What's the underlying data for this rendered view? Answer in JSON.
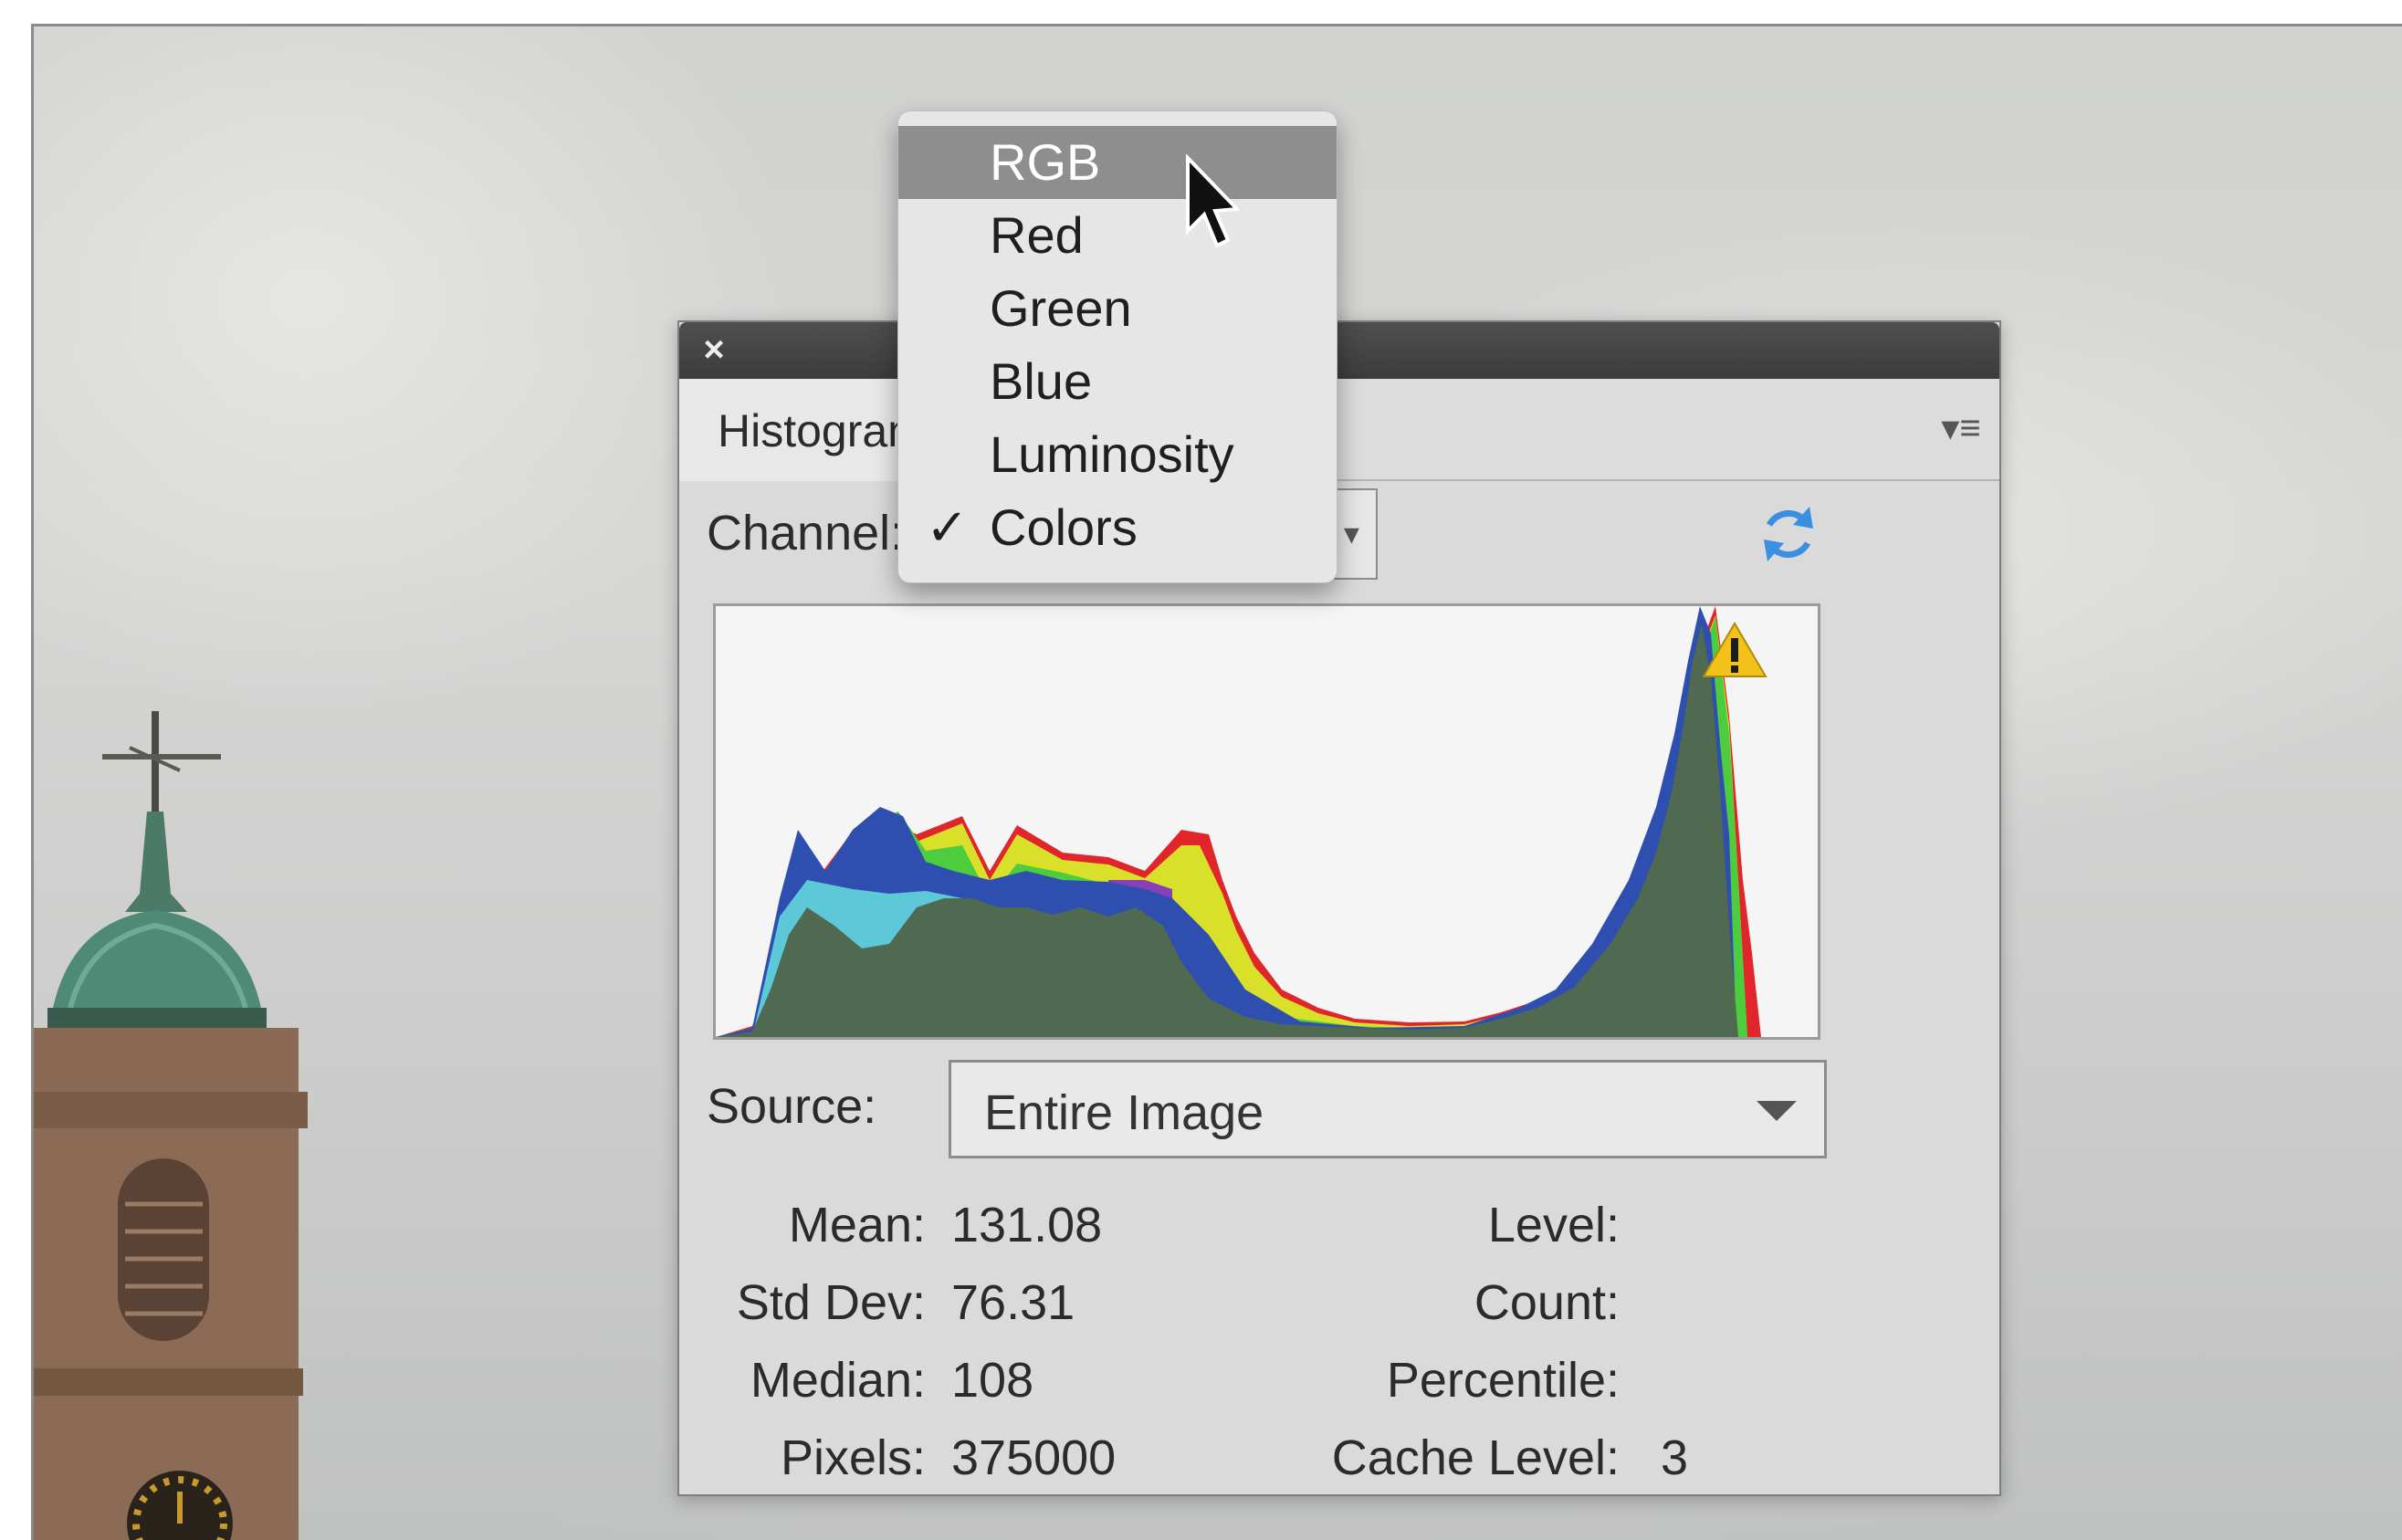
{
  "panel": {
    "close_icon": "×",
    "tab_label": "Histogram",
    "menu_icon": "▾≡",
    "channel_label": "Channel:",
    "source_label": "Source:",
    "source_value": "Entire Image"
  },
  "channel_menu": {
    "items": [
      {
        "label": "RGB",
        "checked": false,
        "highlighted": true
      },
      {
        "label": "Red",
        "checked": false,
        "highlighted": false
      },
      {
        "label": "Green",
        "checked": false,
        "highlighted": false
      },
      {
        "label": "Blue",
        "checked": false,
        "highlighted": false
      },
      {
        "label": "Luminosity",
        "checked": false,
        "highlighted": false
      },
      {
        "label": "Colors",
        "checked": true,
        "highlighted": false
      }
    ],
    "check_mark": "✓"
  },
  "stats": {
    "mean_label": "Mean:",
    "mean_value": "131.08",
    "stddev_label": "Std Dev:",
    "stddev_value": "76.31",
    "median_label": "Median:",
    "median_value": "108",
    "pixels_label": "Pixels:",
    "pixels_value": "375000",
    "level_label": "Level:",
    "level_value": "",
    "count_label": "Count:",
    "count_value": "",
    "percentile_label": "Percentile:",
    "percentile_value": "",
    "cache_label": "Cache Level:",
    "cache_value": "3"
  },
  "icons": {
    "close": "close-icon",
    "refresh": "refresh-icon",
    "warning": "warning-icon",
    "cursor": "pointer-cursor-icon"
  },
  "colors": {
    "panel_bg": "#dadada",
    "titlebar": "#444444",
    "hist_green": "#4f6a50",
    "hist_blue": "#2f4fb0",
    "hist_cyan": "#5cc8d8",
    "hist_red": "#e0262a",
    "hist_yellow": "#d8e02a",
    "hist_lime": "#4ccd3e",
    "hist_purple": "#8a3fb5",
    "refresh_blue": "#3b8fe0",
    "warning_yellow": "#f2c21b"
  }
}
